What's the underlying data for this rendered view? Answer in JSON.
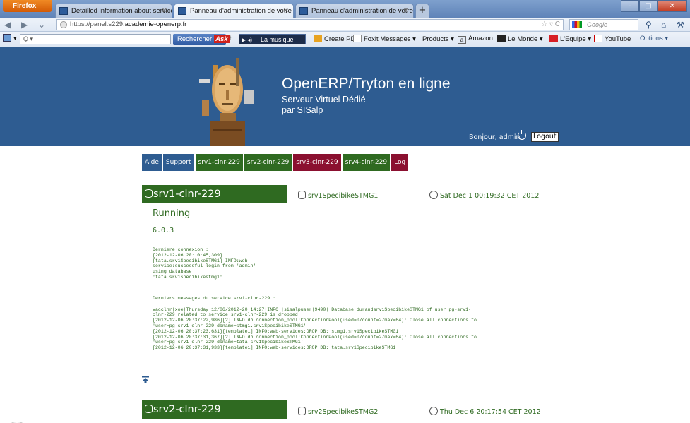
{
  "browser": {
    "menu_label": "Firefox",
    "tabs": [
      {
        "label": "Detailled information about service sr...",
        "active": false
      },
      {
        "label": "Panneau d'administration de votre se...",
        "active": true
      },
      {
        "label": "Panneau d'administration de votre se...",
        "active": false
      }
    ],
    "new_tab": "+",
    "url_prefix": "https://panel.s229.",
    "url_host": "academie-openerp.fr",
    "search_placeholder": "Google",
    "quick_search_value": "Q ▾",
    "ask_button": "Rechercher",
    "ask_logo": "Ask",
    "radio_label": "La musique",
    "bookmarks": [
      "Create PDF",
      "Foxit Messages ▾",
      "Products ▾",
      "Amazon",
      "Le Monde ▾",
      "L'Equipe ▾",
      "YouTube"
    ],
    "options_label": "Options ▾"
  },
  "header": {
    "title": "OpenERP/Tryton en ligne",
    "subtitle_1": "Serveur Virtuel Dédié",
    "subtitle_2": "par SISalp",
    "greeting": "Bonjour, admin",
    "logout": "Logout"
  },
  "nav": [
    {
      "label": "Aide",
      "color": "blue"
    },
    {
      "label": "Support",
      "color": "blue"
    },
    {
      "label": "srv1-clnr-229",
      "color": "green"
    },
    {
      "label": "srv2-clnr-229",
      "color": "green"
    },
    {
      "label": "srv3-clnr-229",
      "color": "red"
    },
    {
      "label": "srv4-clnr-229",
      "color": "green"
    },
    {
      "label": "Log",
      "color": "red"
    }
  ],
  "services": [
    {
      "name": "srv1-clnr-229",
      "database": "srv1SpecibikeSTMG1",
      "date": "Sat Dec 1 00:19:32 CET 2012",
      "status": "Running",
      "version": "6.0.3",
      "last_connection": "Derniere connexion :\n[2012-12-06 20:10:45,309]\n[tata.srv1SpecibikeSTMG1] INFO:web-\nservice:successful login from 'admin'\nusing database\n'tata.srv1specibikestmg1'",
      "messages": "Derniers messages du service srv1-clnr-229 :\n--------------------------------------------\nvacclnr|xoe|Thursday_12/06/2012-20:14:27|INFO |sisalpuser|9490| Database durandsrv1SpecibikeSTMG1 of user pg-srv1-\nclnr-229 related to service srv1-clnr-229 is dropped\n[2012-12-06 20:37:22,986][?] INFO:db.connection_pool:ConnectionPool(used=0/count=2/max=64): Close all connections to\n'user=pg-srv1-clnr-229 dbname=stmg1.srv1SpecibikeSTMG1'\n[2012-12-06 20:37:23,631][template1] INFO:web-services:DROP DB: stmg1.srv1SpecibikeSTMG1\n[2012-12-06 20:37:31,367][?] INFO:db.connection_pool:ConnectionPool(used=0/count=2/max=64): Close all connections to\n'user=pg-srv1-clnr-229 dbname=tata.srv1SpecibikeSTMG1'\n[2012-12-06 20:37:31,933][template1] INFO:web-services:DROP DB: tata.srv1SpecibikeSTMG1"
    },
    {
      "name": "srv2-clnr-229",
      "database": "srv2SpecibikeSTMG2",
      "date": "Thu Dec 6 20:17:54 CET 2012"
    }
  ],
  "colors": {
    "header_blue": "#2e5c91",
    "service_green": "#2f6a21",
    "alert_red": "#8b1030"
  }
}
